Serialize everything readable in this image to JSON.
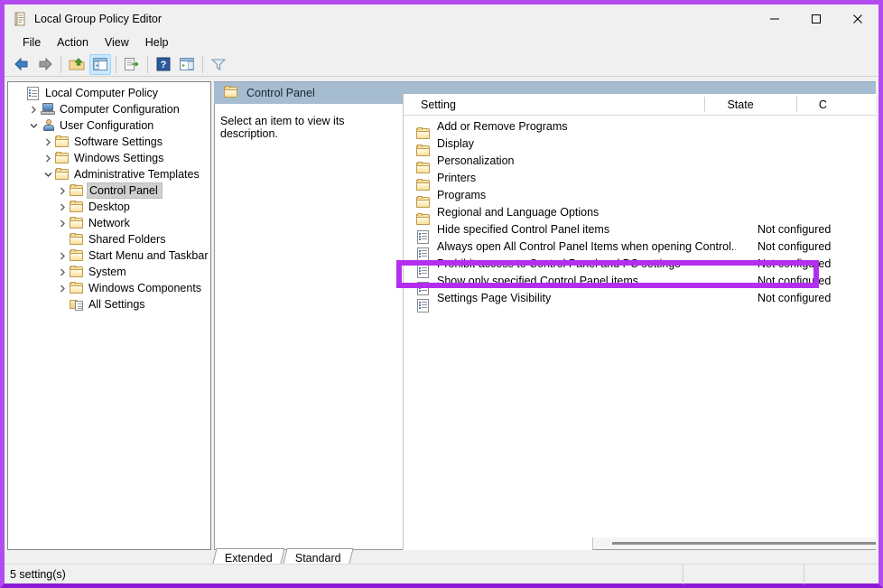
{
  "window": {
    "title": "Local Group Policy Editor",
    "icon": "policy-document-icon",
    "controls": {
      "minimize": "–",
      "maximize": "□",
      "close": "✕"
    }
  },
  "menu": {
    "items": [
      "File",
      "Action",
      "View",
      "Help"
    ]
  },
  "toolbar": {
    "buttons": [
      {
        "name": "back-icon",
        "glyph": "◀"
      },
      {
        "name": "forward-icon",
        "glyph": "▶"
      },
      {
        "name": "up-folder-icon",
        "glyph": "↑"
      },
      {
        "name": "show-hide-console-tree-icon",
        "glyph": "▤"
      },
      {
        "name": "export-list-icon",
        "glyph": "⇥"
      },
      {
        "name": "help-icon",
        "glyph": "?"
      },
      {
        "name": "show-hide-action-pane-icon",
        "glyph": "▥"
      },
      {
        "name": "filter-icon",
        "glyph": "▽"
      }
    ]
  },
  "tree": {
    "items": [
      {
        "label": "Local Computer Policy",
        "indent": 0,
        "twisty": "none",
        "icon": "policy-document-icon",
        "selected": false
      },
      {
        "label": "Computer Configuration",
        "indent": 1,
        "twisty": "collapsed",
        "icon": "computer-icon",
        "selected": false
      },
      {
        "label": "User Configuration",
        "indent": 1,
        "twisty": "expanded",
        "icon": "user-icon",
        "selected": false
      },
      {
        "label": "Software Settings",
        "indent": 2,
        "twisty": "collapsed",
        "icon": "folder-icon",
        "selected": false
      },
      {
        "label": "Windows Settings",
        "indent": 2,
        "twisty": "collapsed",
        "icon": "folder-icon",
        "selected": false
      },
      {
        "label": "Administrative Templates",
        "indent": 2,
        "twisty": "expanded",
        "icon": "folder-icon",
        "selected": false
      },
      {
        "label": "Control Panel",
        "indent": 3,
        "twisty": "collapsed",
        "icon": "folder-icon",
        "selected": true
      },
      {
        "label": "Desktop",
        "indent": 3,
        "twisty": "collapsed",
        "icon": "folder-icon",
        "selected": false
      },
      {
        "label": "Network",
        "indent": 3,
        "twisty": "collapsed",
        "icon": "folder-icon",
        "selected": false
      },
      {
        "label": "Shared Folders",
        "indent": 3,
        "twisty": "none",
        "icon": "folder-icon",
        "selected": false
      },
      {
        "label": "Start Menu and Taskbar",
        "indent": 3,
        "twisty": "collapsed",
        "icon": "folder-icon",
        "selected": false
      },
      {
        "label": "System",
        "indent": 3,
        "twisty": "collapsed",
        "icon": "folder-icon",
        "selected": false
      },
      {
        "label": "Windows Components",
        "indent": 3,
        "twisty": "collapsed",
        "icon": "folder-icon",
        "selected": false
      },
      {
        "label": "All Settings",
        "indent": 3,
        "twisty": "none",
        "icon": "all-settings-icon",
        "selected": false
      }
    ]
  },
  "content": {
    "header_title": "Control Panel",
    "header_icon": "folder-icon",
    "description": "Select an item to view its description.",
    "columns": {
      "setting": "Setting",
      "state": "State",
      "comment": "C"
    },
    "rows": [
      {
        "name": "Add or Remove Programs",
        "state": "",
        "icon": "folder-icon"
      },
      {
        "name": "Display",
        "state": "",
        "icon": "folder-icon"
      },
      {
        "name": "Personalization",
        "state": "",
        "icon": "folder-icon"
      },
      {
        "name": "Printers",
        "state": "",
        "icon": "folder-icon"
      },
      {
        "name": "Programs",
        "state": "",
        "icon": "folder-icon"
      },
      {
        "name": "Regional and Language Options",
        "state": "",
        "icon": "folder-icon"
      },
      {
        "name": "Hide specified Control Panel items",
        "state": "Not configured",
        "icon": "policy-setting-icon"
      },
      {
        "name": "Always open All Control Panel Items when opening Control...",
        "state": "Not configured",
        "icon": "policy-setting-icon"
      },
      {
        "name": "Prohibit access to Control Panel and PC settings",
        "state": "Not configured",
        "icon": "policy-setting-icon"
      },
      {
        "name": "Show only specified Control Panel items",
        "state": "Not configured",
        "icon": "policy-setting-icon"
      },
      {
        "name": "Settings Page Visibility",
        "state": "Not configured",
        "icon": "policy-setting-icon"
      }
    ]
  },
  "tabs": {
    "extended": "Extended",
    "standard": "Standard",
    "active": "Standard"
  },
  "status": {
    "count": "5 setting(s)",
    "cell2": "",
    "cell3": ""
  },
  "highlight": {
    "color": "#b42ef0",
    "target_row": "Prohibit access to Control Panel and PC settings"
  },
  "colors": {
    "window_border": "#b34cf0",
    "header_band": "#a6bcd0",
    "chrome": "#f0f0f0",
    "selection": "#cfcfcf"
  }
}
